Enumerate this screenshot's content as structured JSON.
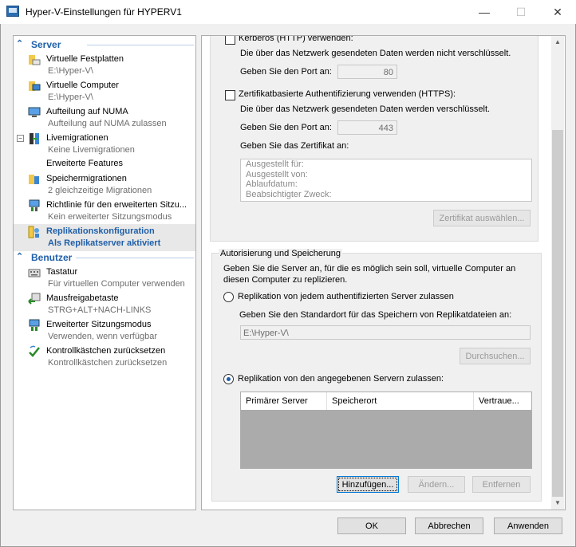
{
  "window": {
    "title": "Hyper-V-Einstellungen für HYPERV1",
    "minimize": "—",
    "maximize": "☐",
    "close": "✕"
  },
  "tree": {
    "server_label": "Server",
    "user_label": "Benutzer",
    "items": [
      {
        "label": "Virtuelle Festplatten",
        "sub": "E:\\Hyper-V\\"
      },
      {
        "label": "Virtuelle Computer",
        "sub": "E:\\Hyper-V\\"
      },
      {
        "label": "Aufteilung auf NUMA",
        "sub": "Aufteilung auf NUMA zulassen"
      },
      {
        "label": "Livemigrationen",
        "sub": "Keine Livemigrationen"
      },
      {
        "label": "Erweiterte Features",
        "sub": ""
      },
      {
        "label": "Speichermigrationen",
        "sub": "2 gleichzeitige Migrationen"
      },
      {
        "label": "Richtlinie für den erweiterten Sitzu...",
        "sub": "Kein erweiterter Sitzungsmodus"
      },
      {
        "label": "Replikationskonfiguration",
        "sub": "Als Replikatserver aktiviert"
      },
      {
        "label": "Tastatur",
        "sub": "Für virtuellen Computer verwenden"
      },
      {
        "label": "Mausfreigabetaste",
        "sub": "STRG+ALT+NACH-LINKS"
      },
      {
        "label": "Erweiterter Sitzungsmodus",
        "sub": "Verwenden, wenn verfügbar"
      },
      {
        "label": "Kontrollkästchen zurücksetzen",
        "sub": "Kontrollkästchen zurücksetzen"
      }
    ]
  },
  "auth": {
    "kerberos_label": "Kerberos (HTTP) verwenden:",
    "kerberos_note": "Die über das Netzwerk gesendeten Daten werden nicht verschlüsselt.",
    "port_label": "Geben Sie den Port an:",
    "kerberos_port": "80",
    "cert_label": "Zertifikatbasierte Authentifizierung verwenden (HTTPS):",
    "cert_note": "Die über das Netzwerk gesendeten Daten werden verschlüsselt.",
    "cert_port": "443",
    "cert_prompt": "Geben Sie das Zertifikat an:",
    "cert_fields": [
      "Ausgestellt für:",
      "Ausgestellt von:",
      "Ablaufdatum:",
      "Beabsichtigter Zweck:"
    ],
    "cert_button": "Zertifikat auswählen..."
  },
  "storage": {
    "title": "Autorisierung und Speicherung",
    "desc": "Geben Sie die Server an, für die es möglich sein soll, virtuelle Computer an diesen Computer zu replizieren.",
    "any_label": "Replikation von jedem authentifizierten Server zulassen",
    "location_label": "Geben Sie den Standardort für das Speichern von Replikatdateien an:",
    "location_value": "E:\\Hyper-V\\",
    "browse": "Durchsuchen...",
    "specific_label": "Replikation von den angegebenen Servern zulassen:",
    "columns": [
      "Primärer Server",
      "Speicherort",
      "Vertraue..."
    ],
    "add": "Hinzufügen...",
    "edit": "Ändern...",
    "remove": "Entfernen"
  },
  "footer": {
    "ok": "OK",
    "cancel": "Abbrechen",
    "apply": "Anwenden"
  }
}
